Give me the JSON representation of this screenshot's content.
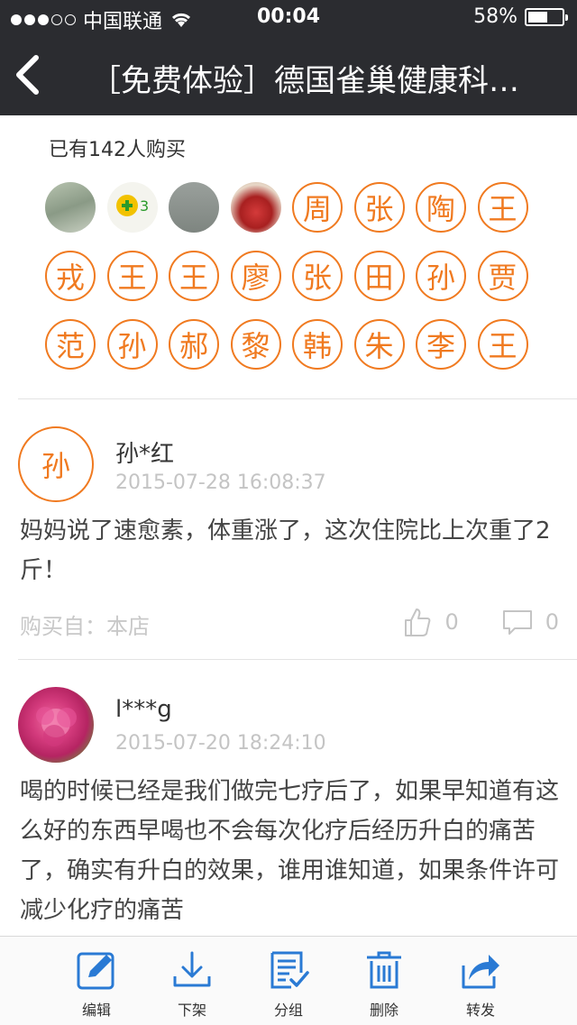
{
  "status_bar": {
    "carrier": "中国联通",
    "time": "00:04",
    "battery_percent_text": "58%",
    "battery_level": 0.58,
    "signal_bars_filled": 3,
    "signal_bars_total": 5
  },
  "nav": {
    "title": "［免费体验］德国雀巢健康科…"
  },
  "buyers": {
    "count_text": "已有142人购买",
    "avatars": [
      {
        "type": "photo",
        "icon": "photo-person-outdoor"
      },
      {
        "type": "photo",
        "icon": "photo-logo-green"
      },
      {
        "type": "photo",
        "icon": "photo-gray"
      },
      {
        "type": "photo",
        "icon": "photo-wedding"
      },
      {
        "type": "letter",
        "char": "周"
      },
      {
        "type": "letter",
        "char": "张"
      },
      {
        "type": "letter",
        "char": "陶"
      },
      {
        "type": "letter",
        "char": "王"
      },
      {
        "type": "letter",
        "char": "戎"
      },
      {
        "type": "letter",
        "char": "王"
      },
      {
        "type": "letter",
        "char": "王"
      },
      {
        "type": "letter",
        "char": "廖"
      },
      {
        "type": "letter",
        "char": "张"
      },
      {
        "type": "letter",
        "char": "田"
      },
      {
        "type": "letter",
        "char": "孙"
      },
      {
        "type": "letter",
        "char": "贾"
      },
      {
        "type": "letter",
        "char": "范"
      },
      {
        "type": "letter",
        "char": "孙"
      },
      {
        "type": "letter",
        "char": "郝"
      },
      {
        "type": "letter",
        "char": "黎"
      },
      {
        "type": "letter",
        "char": "韩"
      },
      {
        "type": "letter",
        "char": "朱"
      },
      {
        "type": "letter",
        "char": "李"
      },
      {
        "type": "letter",
        "char": "王"
      }
    ]
  },
  "reviews": [
    {
      "avatar_char": "孙",
      "name": "孙*红",
      "date": "2015-07-28 16:08:37",
      "text": "妈妈说了速愈素，体重涨了，这次住院比上次重了2斤！",
      "source": "购买自：本店",
      "likes": "0",
      "comments": "0"
    },
    {
      "avatar_icon": "peony-flower-photo",
      "name": "l***g",
      "date": "2015-07-20 18:24:10",
      "text": "喝的时候已经是我们做完七疗后了，如果早知道有这么好的东西早喝也不会每次化疗后经历升白的痛苦了，确实有升白的效果，谁用谁知道，如果条件许可减少化疗的痛苦"
    }
  ],
  "toolbar": {
    "items": [
      {
        "label": "编辑",
        "icon": "edit-icon"
      },
      {
        "label": "下架",
        "icon": "download-icon"
      },
      {
        "label": "分组",
        "icon": "group-list-icon"
      },
      {
        "label": "删除",
        "icon": "trash-icon"
      },
      {
        "label": "转发",
        "icon": "share-icon"
      }
    ]
  },
  "colors": {
    "bar_bg": "#2b2c30",
    "accent_orange": "#f07a20",
    "toolbar_icon_blue": "#2a7ad4",
    "muted_gray": "#c4c4c4"
  }
}
